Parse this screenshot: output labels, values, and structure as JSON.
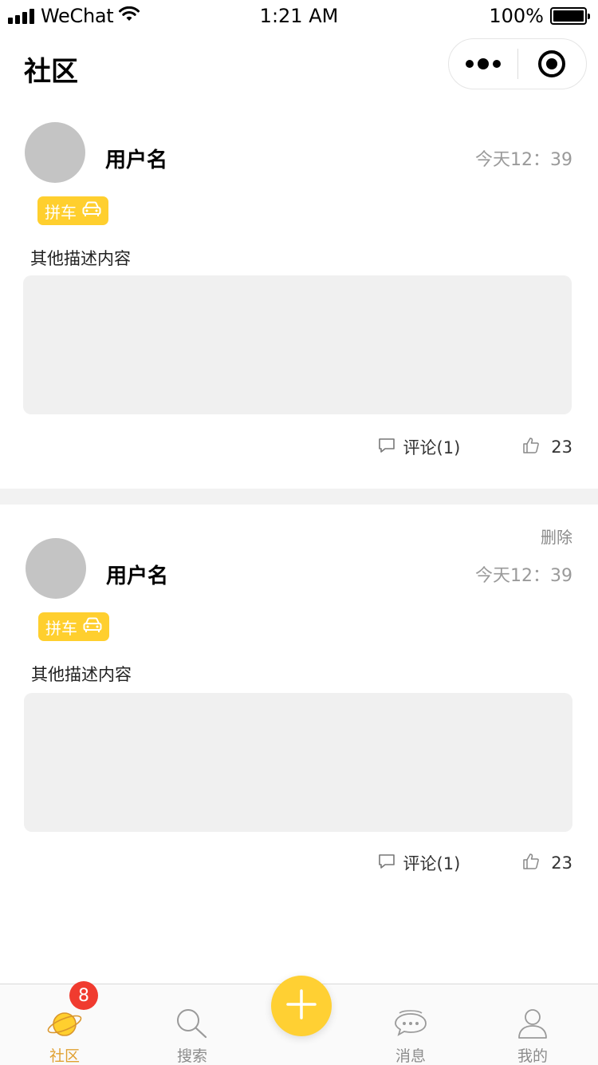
{
  "status_bar": {
    "carrier": "WeChat",
    "time": "1:21 AM",
    "battery": "100%"
  },
  "nav": {
    "title": "社区"
  },
  "posts": [
    {
      "username": "用户名",
      "time": "今天12：39",
      "tag": "拼车",
      "description": "其他描述内容",
      "comment_label": "评论(1)",
      "likes": "23",
      "delete_label": ""
    },
    {
      "username": "用户名",
      "time": "今天12：39",
      "tag": "拼车",
      "description": "其他描述内容",
      "comment_label": "评论(1)",
      "likes": "23",
      "delete_label": "删除"
    }
  ],
  "tabbar": {
    "community": "社区",
    "community_badge": "8",
    "search": "搜索",
    "messages": "消息",
    "mine": "我的"
  },
  "colors": {
    "accent": "#ffcf2e",
    "active_tab": "#e0a132",
    "badge": "#f03b2f"
  },
  "icons": [
    "signal-icon",
    "wifi-icon",
    "battery-icon",
    "more-icon",
    "close-target-icon",
    "car-icon",
    "comment-icon",
    "thumbs-up-icon",
    "planet-icon",
    "search-icon",
    "plus-icon",
    "chat-icon",
    "user-icon"
  ]
}
